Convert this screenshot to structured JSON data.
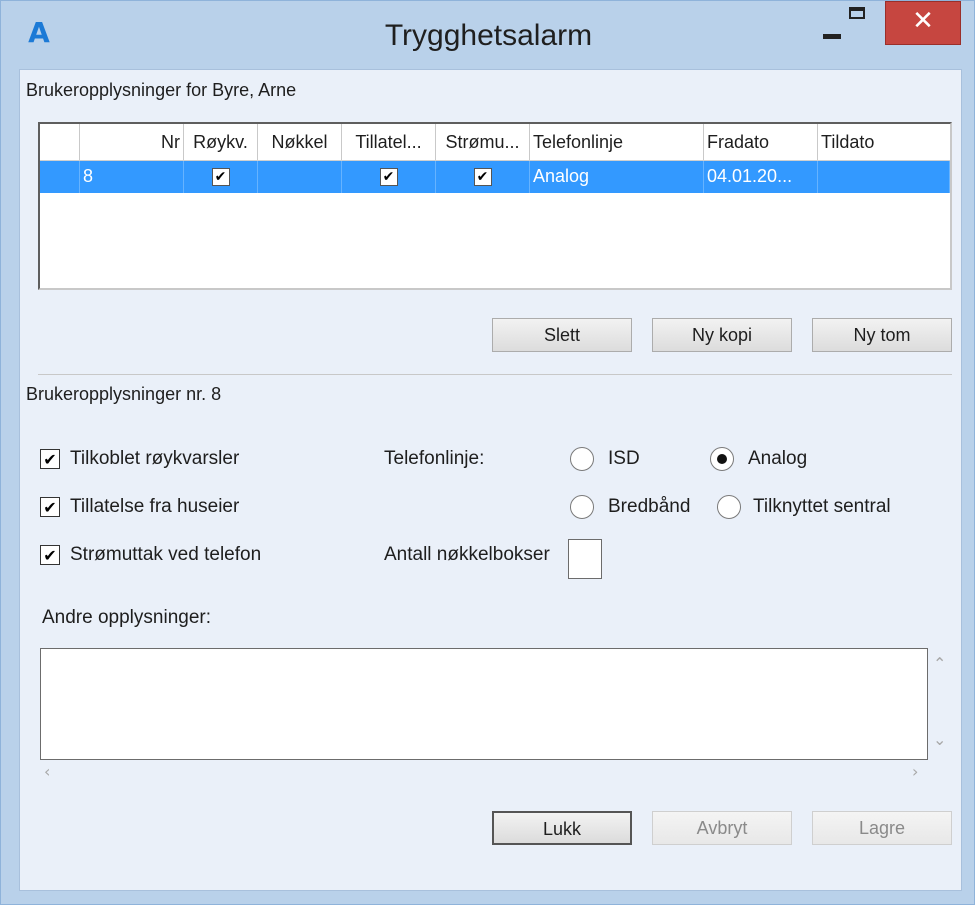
{
  "window": {
    "title": "Trygghetsalarm",
    "app_icon_glyph": "A",
    "minimize_glyph": "",
    "close_glyph": "✕"
  },
  "user_section": {
    "title": "Brukeropplysninger for Byre, Arne"
  },
  "grid": {
    "columns": [
      "Nr",
      "Røykv.",
      "Nøkkel",
      "Tillatel...",
      "Strømu...",
      "Telefonlinje",
      "Fradato",
      "Tildato"
    ],
    "rows": [
      {
        "nr": "8",
        "roykv": true,
        "nokkel": false,
        "tillatelse": true,
        "stromuttak": true,
        "telefonlinje": "Analog",
        "fradato": "04.01.20...",
        "tildato": ""
      }
    ]
  },
  "grid_buttons": {
    "slett": "Slett",
    "ny_kopi": "Ny kopi",
    "ny_tom": "Ny tom"
  },
  "detail_section": {
    "title": "Brukeropplysninger nr. 8",
    "checkboxes": [
      {
        "label": "Tilkoblet røykvarsler",
        "checked": true
      },
      {
        "label": "Tillatelse fra huseier",
        "checked": true
      },
      {
        "label": "Strømuttak ved telefon",
        "checked": true
      }
    ],
    "telefonlinje_label": "Telefonlinje:",
    "radios": [
      {
        "label": "ISD",
        "selected": false
      },
      {
        "label": "Analog",
        "selected": true
      },
      {
        "label": "Bredbånd",
        "selected": false
      },
      {
        "label": "Tilknyttet sentral",
        "selected": false
      }
    ],
    "nokkelbokser_label": "Antall nøkkelbokser",
    "nokkelbokser_value": "",
    "andre_label": "Andre opplysninger:",
    "andre_value": ""
  },
  "footer_buttons": {
    "lukk": "Lukk",
    "avbryt": "Avbryt",
    "lagre": "Lagre"
  },
  "colors": {
    "title_bg": "#b9d1ea",
    "selection": "#3399ff",
    "close": "#c64640"
  }
}
